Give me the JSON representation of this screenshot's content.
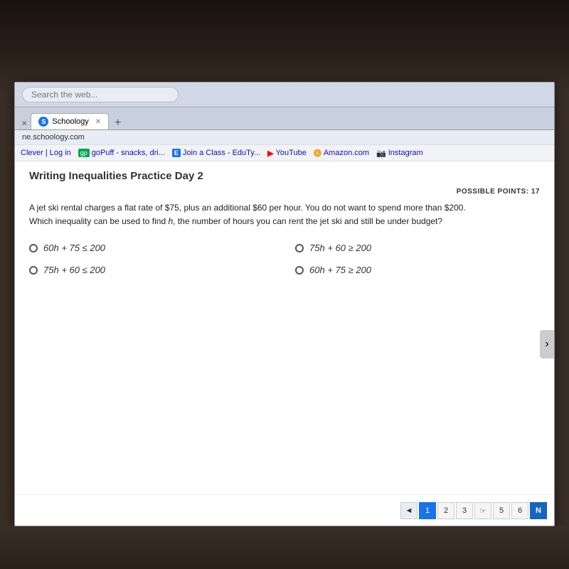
{
  "browser": {
    "search_placeholder": "Search the web...",
    "address": "ne.schoology.com",
    "tab_label": "Schoology",
    "tab_icon": "S",
    "bookmarks": [
      {
        "label": "Clever | Log in",
        "icon": ""
      },
      {
        "label": "goPuff - snacks, dri...",
        "icon": "gp"
      },
      {
        "label": "Join a Class - EduTy...",
        "icon": "E"
      },
      {
        "label": "YouTube",
        "icon": "yt"
      },
      {
        "label": "Amazon.com",
        "icon": "a"
      },
      {
        "label": "Instagram",
        "icon": "ig"
      }
    ]
  },
  "page": {
    "title": "Writing Inequalities Practice Day 2",
    "possible_points_label": "POSSIBLE POINTS: 17",
    "question": "A jet ski rental charges a flat rate of $75, plus an additional $60 per hour. You do not want to spend more than $200. Which inequality can be used to find h, the number of hours you can rent the jet ski and still be under budget?",
    "answers": [
      {
        "id": "a",
        "expr": "60h + 75 ≤ 200"
      },
      {
        "id": "b",
        "expr": "75h + 60 ≥ 200"
      },
      {
        "id": "c",
        "expr": "75h + 60 ≤ 200"
      },
      {
        "id": "d",
        "expr": "60h + 75 ≥ 200"
      }
    ],
    "pagination": {
      "prev_label": "◄",
      "pages": [
        "1",
        "2",
        "3",
        "4",
        "5",
        "6"
      ],
      "current_page": "1",
      "next_label": "N"
    }
  }
}
